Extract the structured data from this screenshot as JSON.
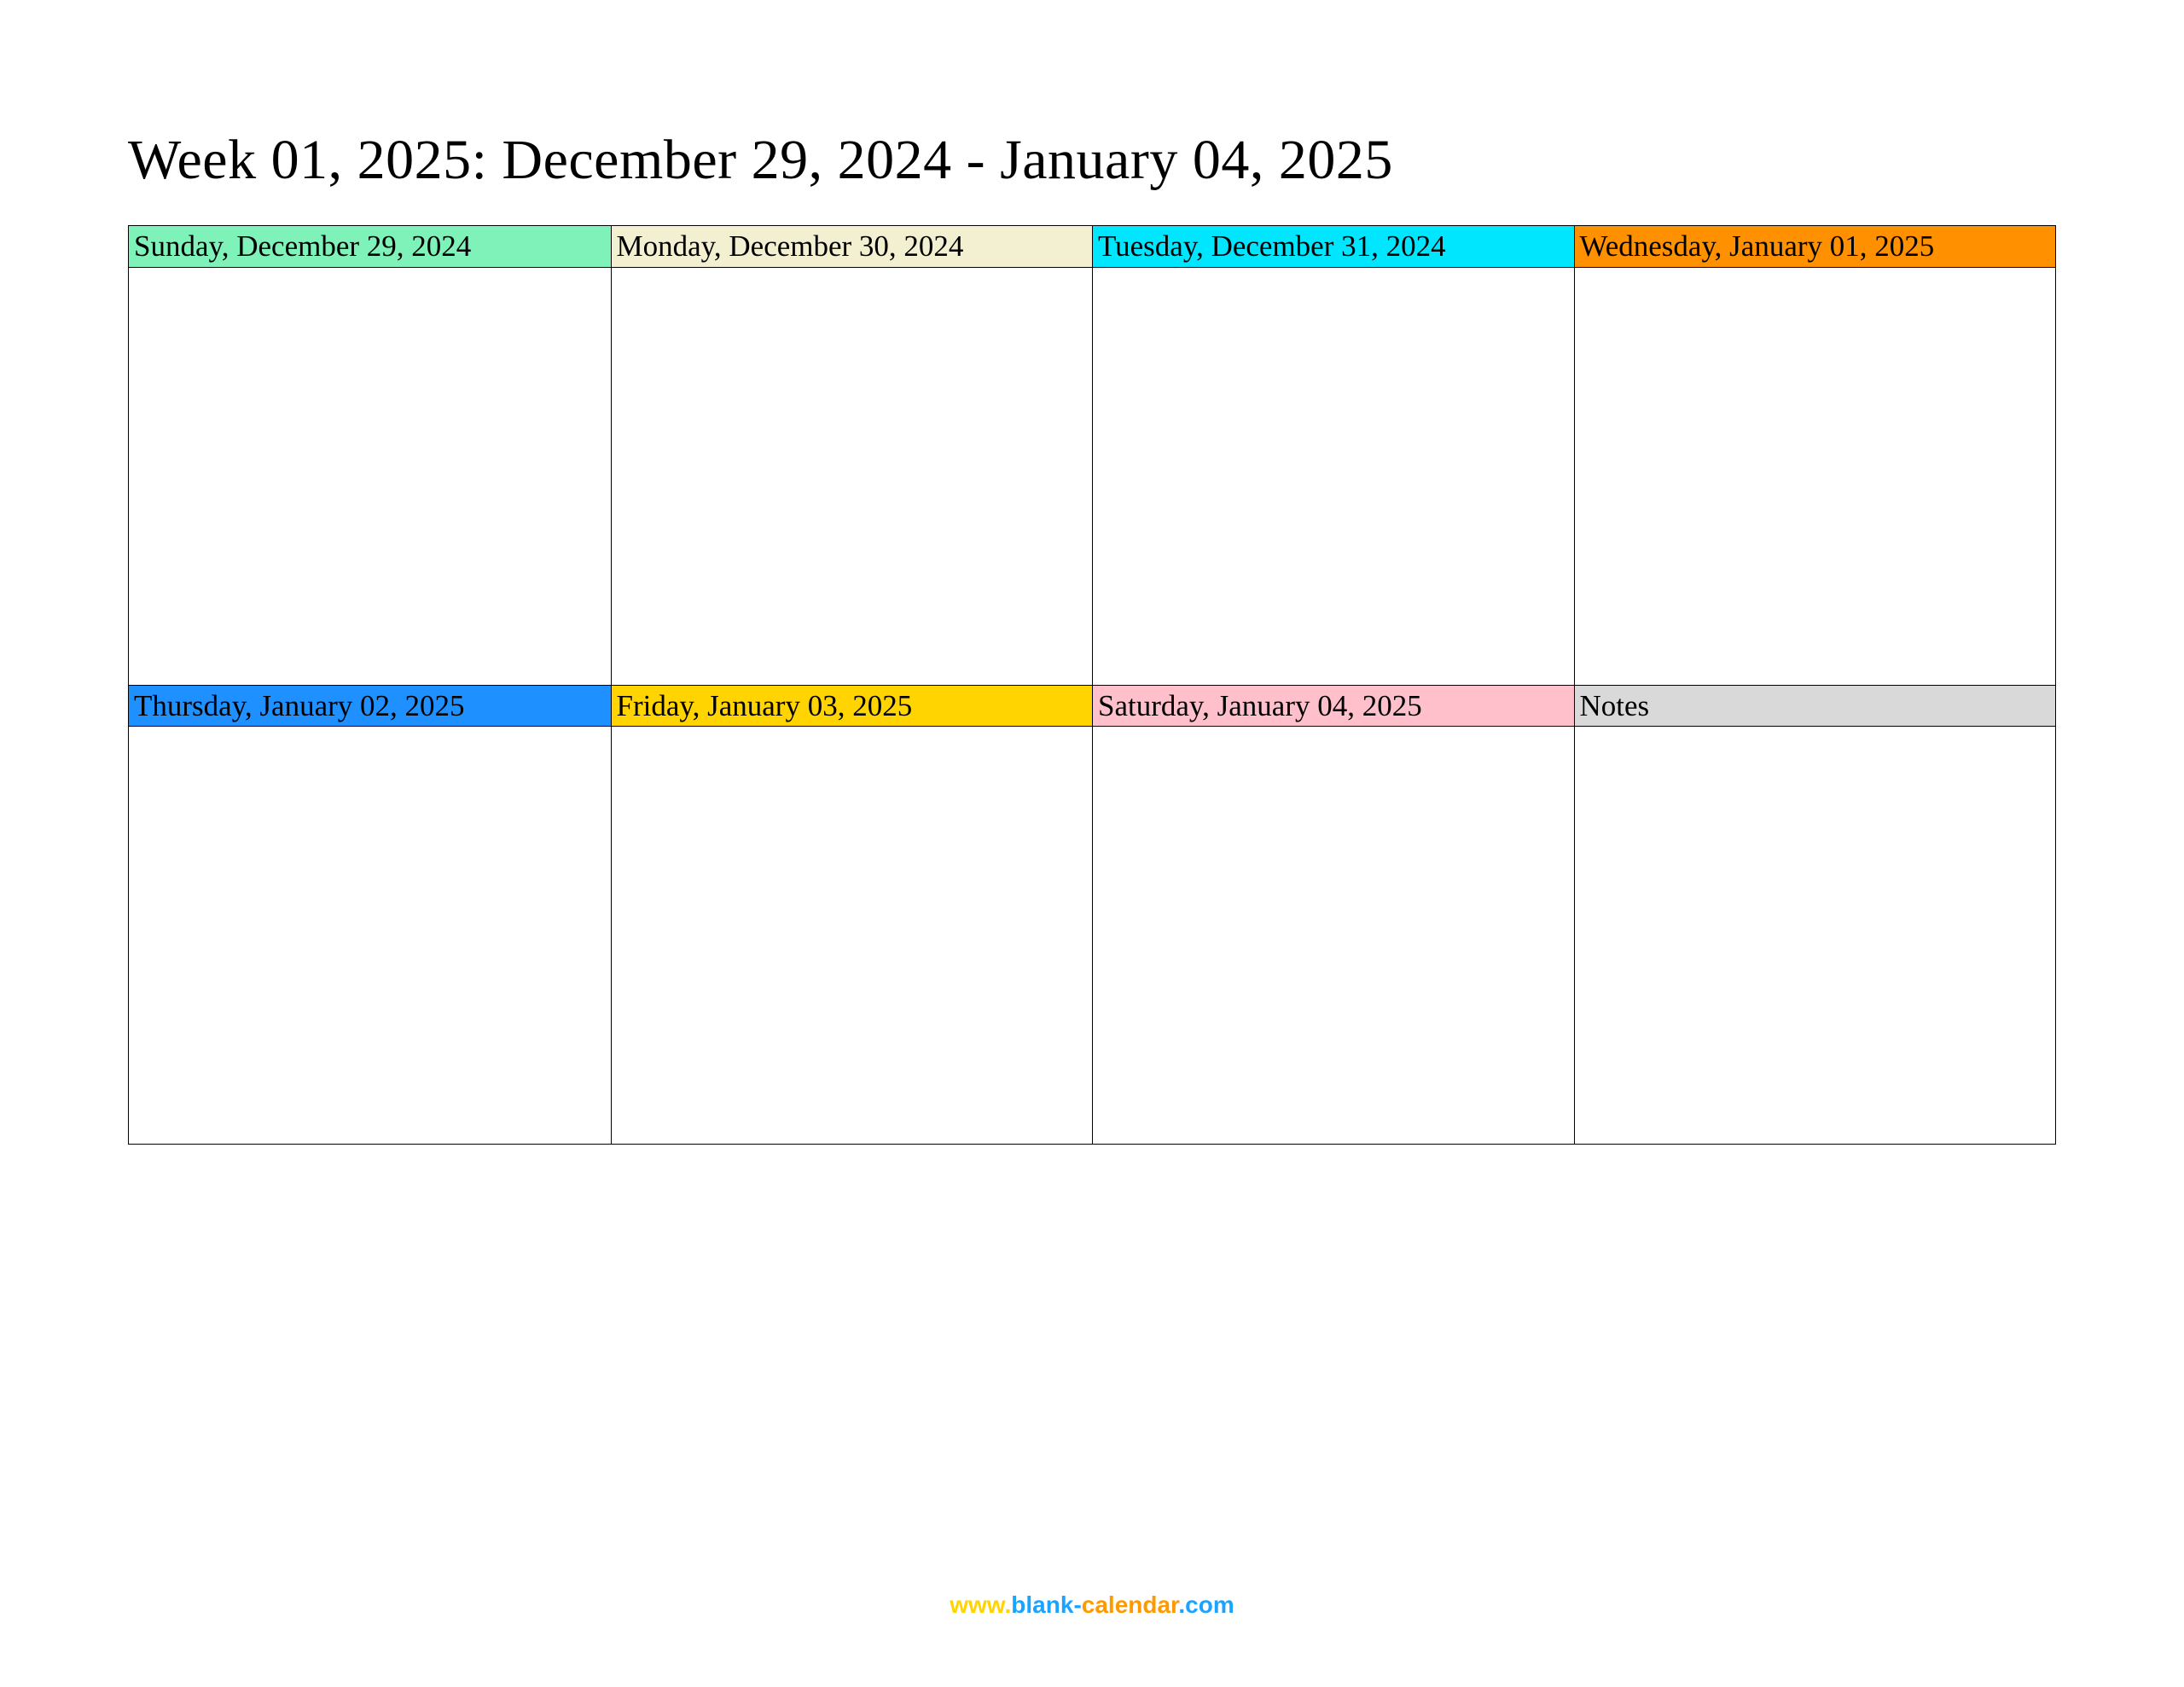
{
  "title": "Week 01, 2025: December 29, 2024 - January 04, 2025",
  "cells": {
    "sunday": {
      "label": "Sunday, December 29, 2024",
      "color": "#7ef2b8"
    },
    "monday": {
      "label": "Monday, December 30, 2024",
      "color": "#f2f0d0"
    },
    "tuesday": {
      "label": "Tuesday, December 31, 2024",
      "color": "#00e6ff"
    },
    "wednesday": {
      "label": "Wednesday, January 01, 2025",
      "color": "#ff9100"
    },
    "thursday": {
      "label": "Thursday, January 02, 2025",
      "color": "#1e90ff"
    },
    "friday": {
      "label": "Friday, January 03, 2025",
      "color": "#ffd400"
    },
    "saturday": {
      "label": "Saturday, January 04, 2025",
      "color": "#ffc0cb"
    },
    "notes": {
      "label": "Notes",
      "color": "#d9d9d9"
    }
  },
  "footer": {
    "www": "www.",
    "blank": "blank",
    "dash": "-",
    "calendar": "calendar",
    "dotcom": ".com"
  }
}
